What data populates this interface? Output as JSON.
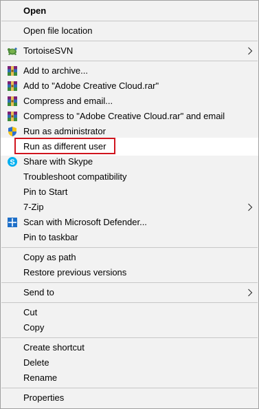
{
  "menu": {
    "items": [
      {
        "label": "Open",
        "bold": true
      },
      {
        "label": "Open file location"
      },
      {
        "label": "TortoiseSVN",
        "icon": "tortoisesvn-icon",
        "submenu": true
      },
      {
        "label": "Add to archive...",
        "icon": "winrar-icon"
      },
      {
        "label": "Add to \"Adobe Creative Cloud.rar\"",
        "icon": "winrar-icon"
      },
      {
        "label": "Compress and email...",
        "icon": "winrar-icon"
      },
      {
        "label": "Compress to \"Adobe Creative Cloud.rar\" and email",
        "icon": "winrar-icon"
      },
      {
        "label": "Run as administrator",
        "icon": "uac-shield-icon"
      },
      {
        "label": "Run as different user",
        "highlighted": true
      },
      {
        "label": "Share with Skype",
        "icon": "skype-icon"
      },
      {
        "label": "Troubleshoot compatibility"
      },
      {
        "label": "Pin to Start"
      },
      {
        "label": "7-Zip",
        "submenu": true
      },
      {
        "label": "Scan with Microsoft Defender...",
        "icon": "defender-icon"
      },
      {
        "label": "Pin to taskbar"
      },
      {
        "label": "Copy as path"
      },
      {
        "label": "Restore previous versions"
      },
      {
        "label": "Send to",
        "submenu": true
      },
      {
        "label": "Cut"
      },
      {
        "label": "Copy"
      },
      {
        "label": "Create shortcut"
      },
      {
        "label": "Delete"
      },
      {
        "label": "Rename"
      },
      {
        "label": "Properties"
      }
    ]
  },
  "colors": {
    "menu_background": "#f2f2f2",
    "highlight_border": "#d0141e",
    "separator": "#c7c7c7"
  }
}
